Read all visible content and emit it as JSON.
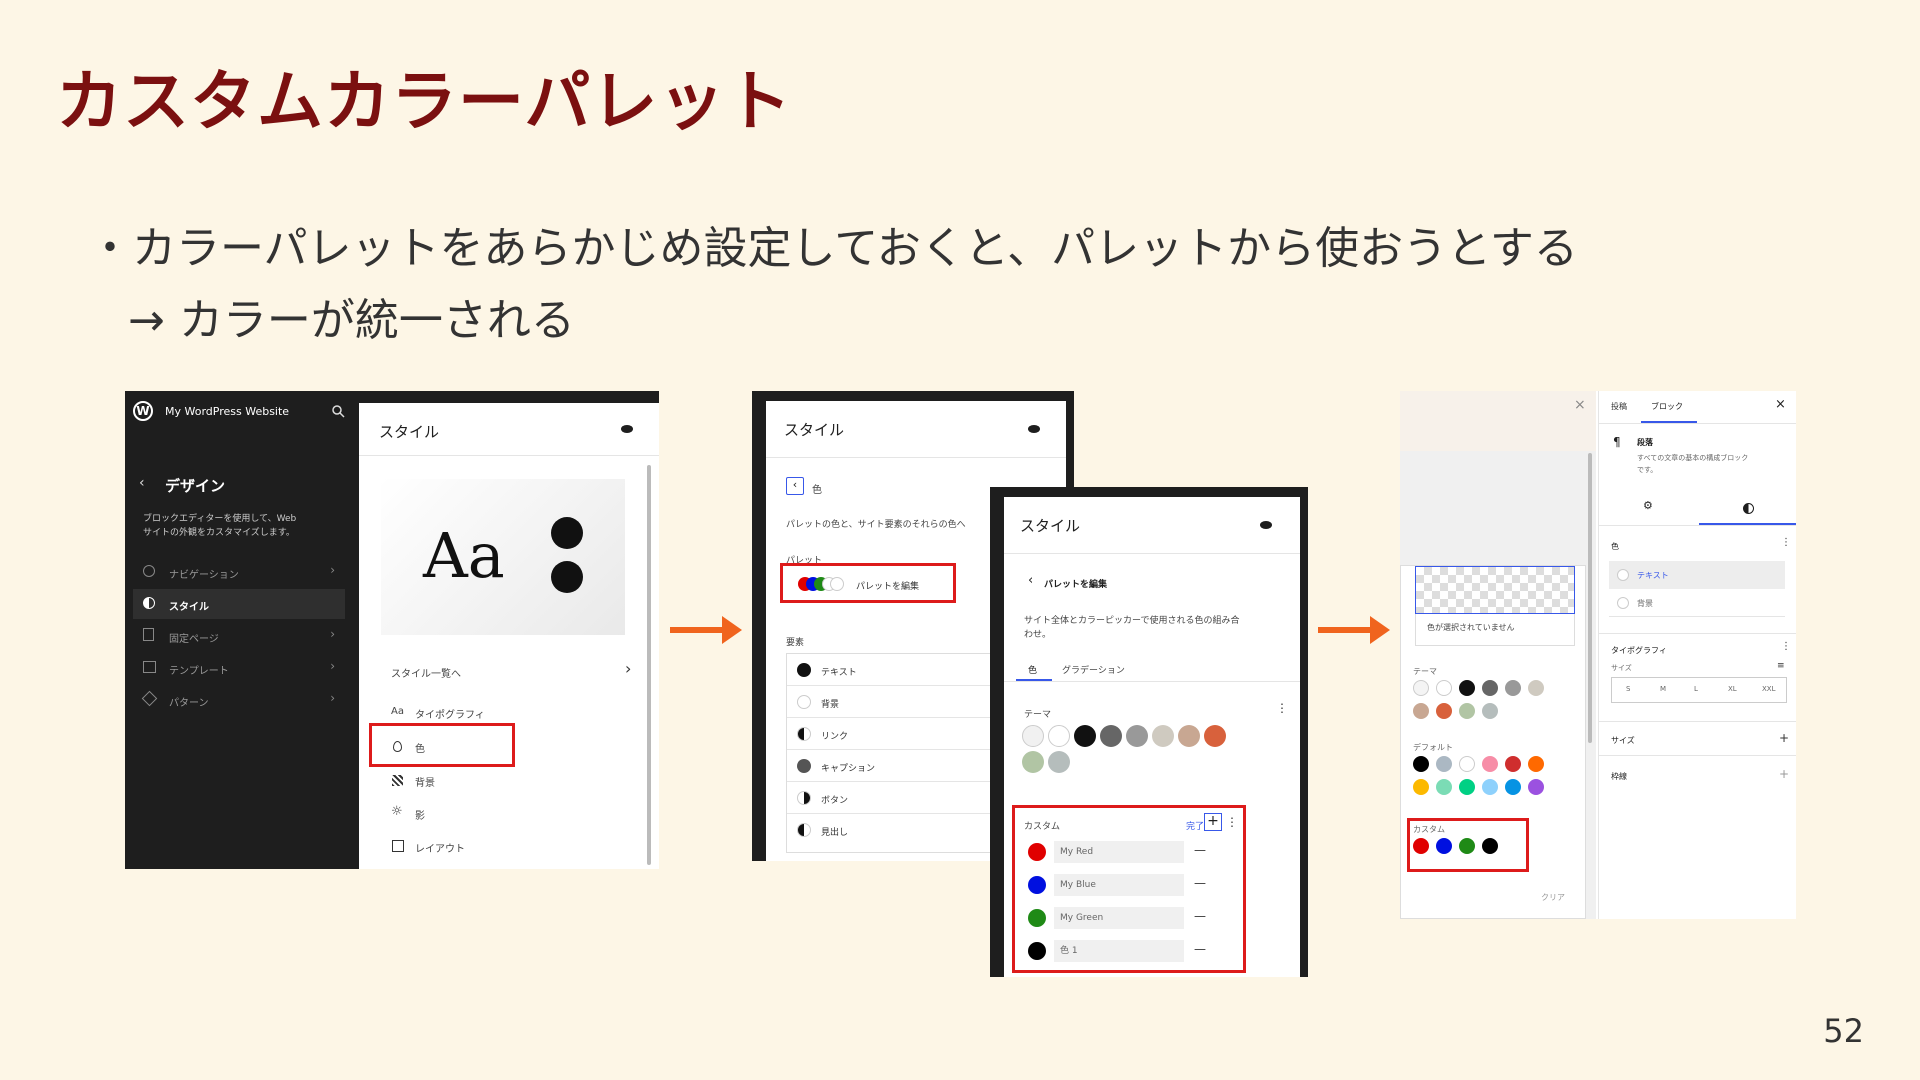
{
  "slide": {
    "title": "カスタムカラーパレット",
    "bullet_line1": "・カラーパレットをあらかじめ設定しておくと、パレットから使おうとする",
    "bullet_line2": "→ カラーが統一される",
    "page_number": "52",
    "arrow_color": "#f0641e",
    "highlight_color": "#dd1b1b",
    "title_color": "#7b1010"
  },
  "shot1": {
    "site_name": "My WordPress Website",
    "design_title": "デザイン",
    "design_desc1": "ブロックエディターを使用して、Web",
    "design_desc2": "サイトの外観をカスタマイズします。",
    "nav_items": [
      "ナビゲーション",
      "スタイル",
      "固定ページ",
      "テンプレート",
      "パターン"
    ],
    "panel_title": "スタイル",
    "preview_text": "Aa",
    "style_list_link": "スタイル一覧へ",
    "menu_items": [
      "タイポグラフィ",
      "色",
      "背景",
      "影",
      "レイアウト"
    ],
    "menu_prefix": "Aa"
  },
  "shot2": {
    "panel_title": "スタイル",
    "back_label": "色",
    "desc": "パレットの色と、サイト要素のそれらの色へ",
    "palette_label": "パレット",
    "edit_palette": "パレットを編集",
    "elements_label": "要素",
    "elements": [
      "テキスト",
      "背景",
      "リンク",
      "キャプション",
      "ボタン",
      "見出し"
    ]
  },
  "shot3": {
    "panel_title": "スタイル",
    "back_label": "パレットを編集",
    "desc1": "サイト全体とカラーピッカーで使用される色の組み合",
    "desc2": "わせ。",
    "tab_color": "色",
    "tab_gradient": "グラデーション",
    "theme_label": "テーマ",
    "custom_label": "カスタム",
    "done_label": "完了",
    "custom_colors": [
      {
        "name": "My Red",
        "color": "#e00000"
      },
      {
        "name": "My Blue",
        "color": "#0010e0"
      },
      {
        "name": "My Green",
        "color": "#1f8a16"
      },
      {
        "name": "色 1",
        "color": "#000000"
      }
    ],
    "theme_colors": [
      "#f1f1f1",
      "#ffffff",
      "#111111",
      "#666666",
      "#999999",
      "#cfcac0",
      "#c8a792",
      "#d8613c",
      "#b1c5a4",
      "#b5bdbc"
    ]
  },
  "shot4": {
    "tab_post": "投稿",
    "tab_block": "ブロック",
    "block_name": "段落",
    "block_desc1": "すべての文章の基本の構成ブロック",
    "block_desc2": "です。",
    "color_label": "色",
    "text_label": "テキスト",
    "bg_label": "背景",
    "typography_label": "タイポグラフィ",
    "size_label": "サイズ",
    "sizes": [
      "S",
      "M",
      "L",
      "XL",
      "XXL"
    ],
    "size2_label": "サイズ",
    "border_label": "枠線",
    "no_color_selected": "色が選択されていません",
    "theme_label": "テーマ",
    "default_label": "デフォルト",
    "custom_label": "カスタム",
    "clear_label": "クリア",
    "theme_colors": [
      "#f4f4f4",
      "#ffffff",
      "#111111",
      "#666666",
      "#999999",
      "#cfcac0",
      "#c8a792",
      "#d8613c",
      "#b1c5a4",
      "#b5bdbc"
    ],
    "default_colors": [
      "#000000",
      "#abb8c3",
      "#ffffff",
      "#f78da7",
      "#cf2e2e",
      "#ff6900",
      "#fcb900",
      "#7bdcb5",
      "#00d084",
      "#8ed1fc",
      "#0693e3",
      "#9b51e0"
    ],
    "custom_colors": [
      "#e00000",
      "#0010e0",
      "#1f8a16",
      "#000000"
    ]
  }
}
